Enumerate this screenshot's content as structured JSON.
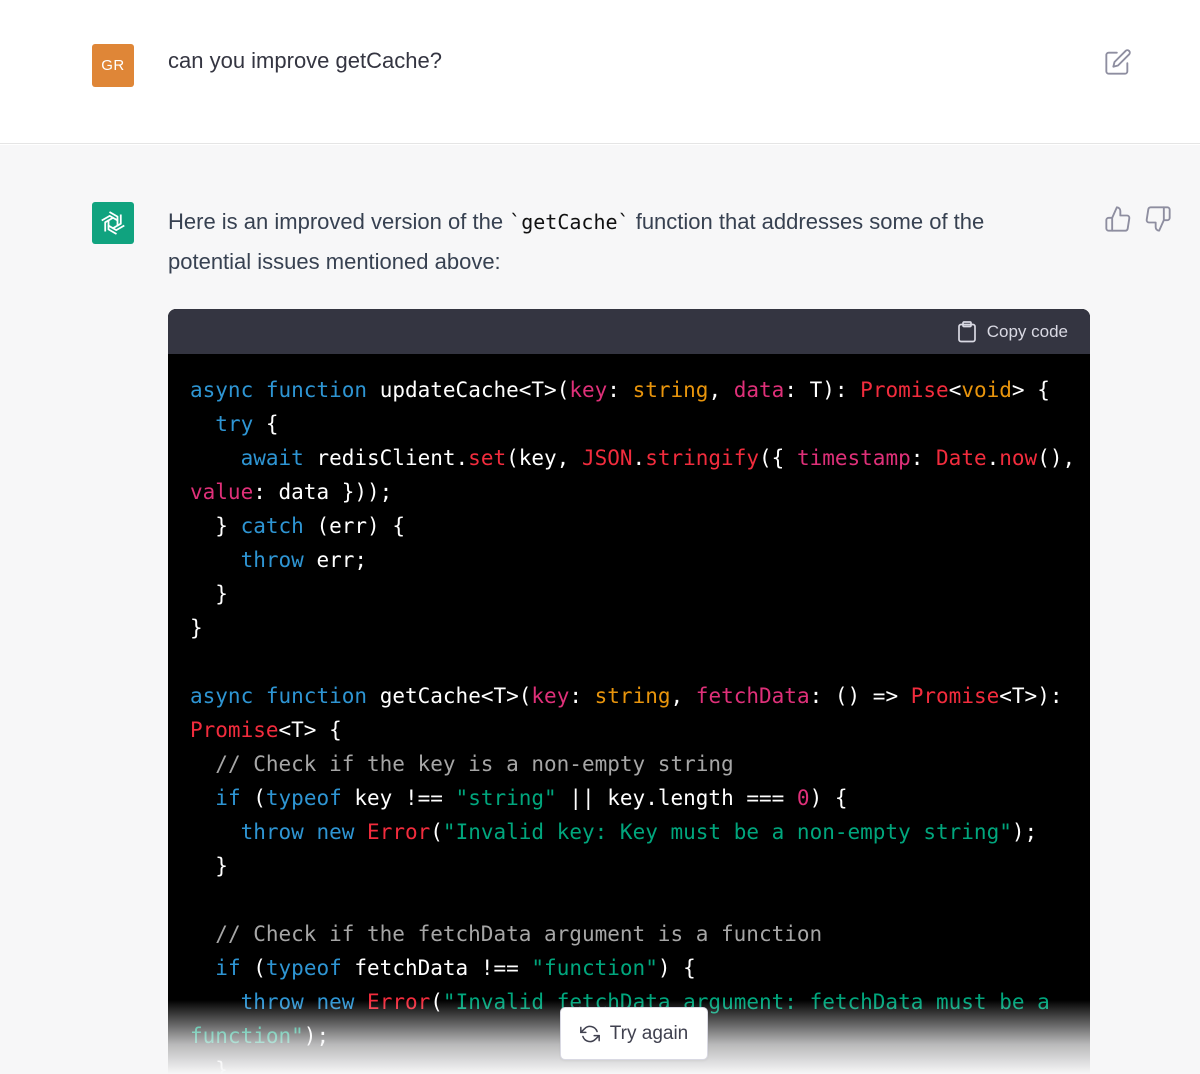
{
  "user_message": {
    "avatar_initials": "GR",
    "text": "can you improve getCache?"
  },
  "assistant_message": {
    "intro_before": "Here is an improved version of the ",
    "intro_code": "`getCache`",
    "intro_after": " function that addresses some of the potential issues mentioned above:",
    "copy_label": "Copy code"
  },
  "actions": {
    "try_again_label": "Try again"
  },
  "code_tokens": {
    "async": "async",
    "function": "function",
    "update_cache_name": "updateCache<T>(",
    "key": "key",
    "colon": ": ",
    "string": "string",
    "comma": ", ",
    "data_param": "data",
    "t_close": ": T): ",
    "promise": "Promise",
    "lt": "<",
    "void": "void",
    "gt_brace": "> {",
    "try": "try",
    "brace_open": " {",
    "await": "await",
    "redis_client": "redisClient.",
    "set": "set",
    "key_arg": "(key, ",
    "json": "JSON",
    "dot": ".",
    "stringify": "stringify",
    "obj_open": "({ ",
    "timestamp": "timestamp",
    "date": "Date",
    "now": "now",
    "now_tail": "(),",
    "value": "value",
    "data_close": "data }));",
    "catch_open": "} ",
    "catch": "catch",
    "err_open": " (err) {",
    "throw": "throw",
    "err_semi": " err;",
    "brace_close": "}",
    "get_cache_name": "getCache<T>(",
    "fetch_data": "fetchData",
    "arrow": ": () => ",
    "t_generic": "<T>):",
    "t_generic_brace": "<T> {",
    "comment_key": "// Check if the key is a non-empty string",
    "if": "if",
    "paren_open": " (",
    "typeof": "typeof",
    "key_neq": " key !== ",
    "string_lit": "\"string\"",
    "or_length": " || key.length === ",
    "zero": "0",
    "paren_brace": ") {",
    "new": "new",
    "error": "Error",
    "paren": "(",
    "invalid_key_msg": "\"Invalid key: Key must be a non-empty string\"",
    "close_semi": ");",
    "comment_fetch": "// Check if the fetchData argument is a function",
    "fetch_neq": " fetchData !== ",
    "function_lit": "\"function\"",
    "invalid_fetch_msg": "\"Invalid fetchData argument: fetchData must be a",
    "invalid_fetch_msg_end": "function\""
  },
  "colors": {
    "user_avatar": "#df8637",
    "assistant_avatar": "#10a37f",
    "code_header": "#343541",
    "code_bg": "#000000",
    "keyword": "#2e95d3",
    "type": "#e9950c",
    "param": "#df3079",
    "string": "#00a67d",
    "comment": "#a6a6a6"
  },
  "icons": {
    "edit": "edit-icon",
    "assistant_logo": "openai-logo-icon",
    "thumbs_up": "thumbs-up-icon",
    "thumbs_down": "thumbs-down-icon",
    "clipboard": "clipboard-icon",
    "refresh": "refresh-icon"
  }
}
